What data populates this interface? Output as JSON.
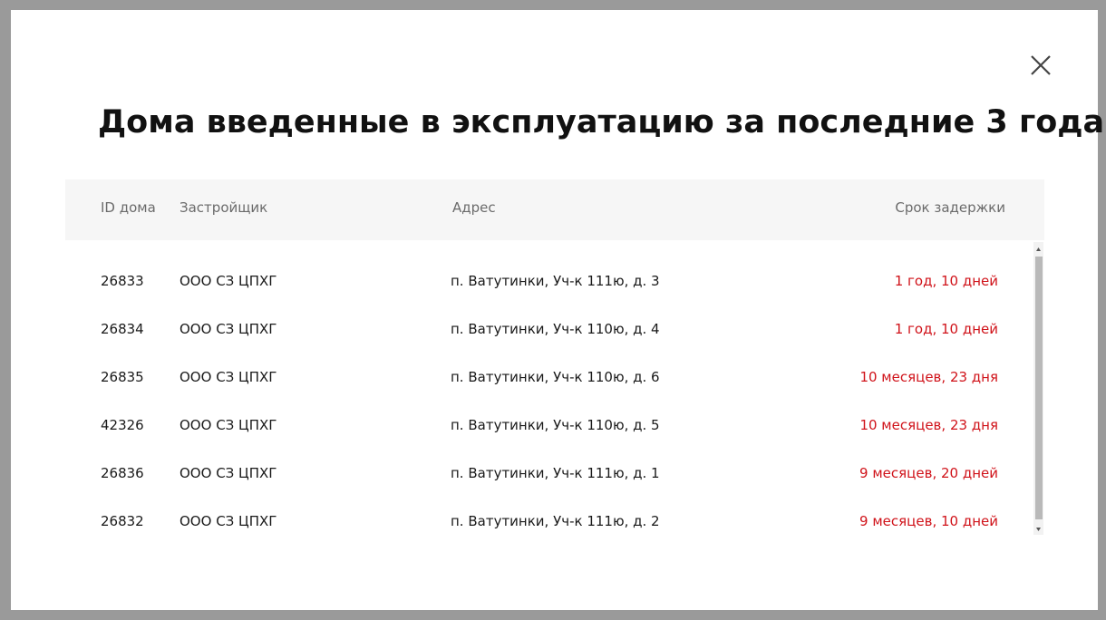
{
  "modal": {
    "title": "Дома введенные в эксплуатацию за последние 3 года",
    "close_icon": "close-icon"
  },
  "table": {
    "headers": {
      "id": "ID дома",
      "developer": "Застройщик",
      "address": "Адрес",
      "delay": "Срок задержки"
    },
    "rows": [
      {
        "id": "26833",
        "developer": "ООО СЗ ЦПХГ",
        "address": "п. Ватутинки, Уч-к 111ю, д. 3",
        "delay": "1 год, 10 дней"
      },
      {
        "id": "26834",
        "developer": "ООО СЗ ЦПХГ",
        "address": "п. Ватутинки, Уч-к 110ю, д. 4",
        "delay": "1 год, 10 дней"
      },
      {
        "id": "26835",
        "developer": "ООО СЗ ЦПХГ",
        "address": "п. Ватутинки, Уч-к 110ю, д. 6",
        "delay": "10 месяцев, 23 дня"
      },
      {
        "id": "42326",
        "developer": "ООО СЗ ЦПХГ",
        "address": "п. Ватутинки, Уч-к 110ю, д. 5",
        "delay": "10 месяцев, 23 дня"
      },
      {
        "id": "26836",
        "developer": "ООО СЗ ЦПХГ",
        "address": "п. Ватутинки, Уч-к 111ю, д. 1",
        "delay": "9 месяцев, 20 дней"
      },
      {
        "id": "26832",
        "developer": "ООО СЗ ЦПХГ",
        "address": "п. Ватутинки, Уч-к 111ю, д. 2",
        "delay": "9 месяцев, 10 дней"
      }
    ]
  },
  "colors": {
    "delay_text": "#d0131a",
    "header_bg": "#f6f6f6",
    "backdrop": "#9a9a9a"
  }
}
